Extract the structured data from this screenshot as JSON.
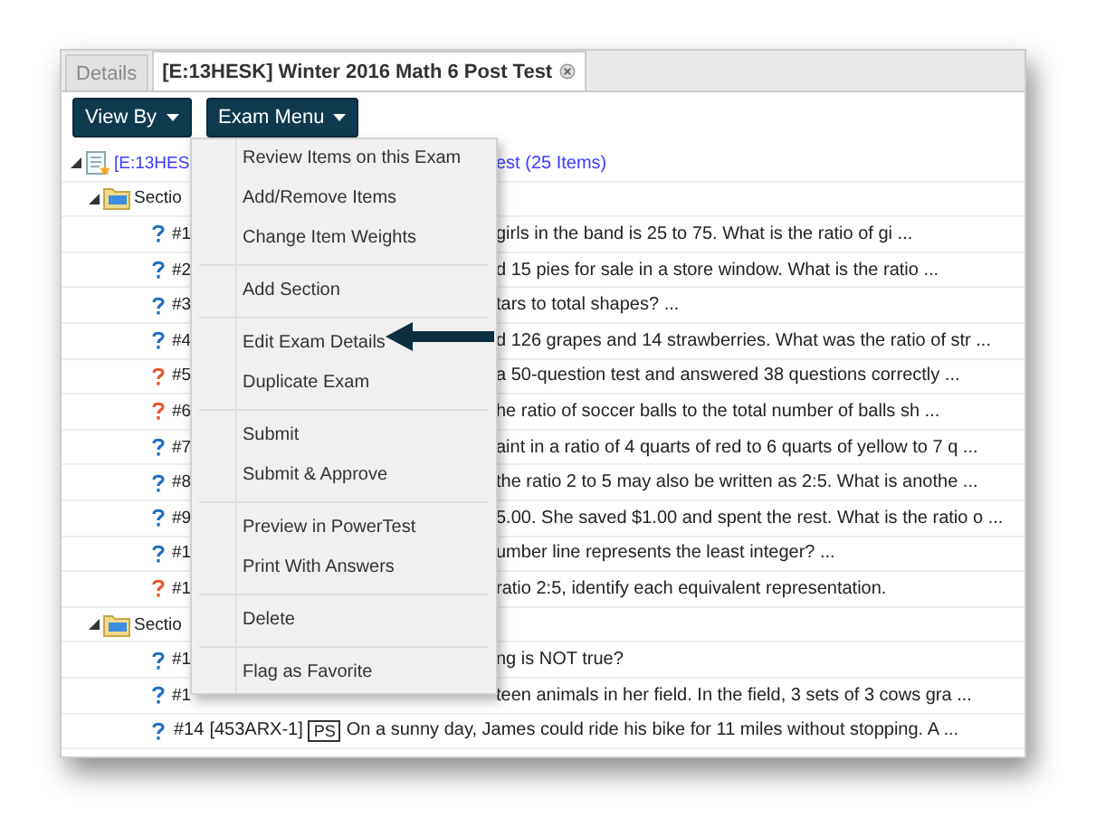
{
  "tabs": [
    {
      "label": "Details",
      "selected": false,
      "closable": false
    },
    {
      "label": "[E:13HESK] Winter 2016 Math 6 Post Test",
      "selected": true,
      "closable": true
    }
  ],
  "toolbar": [
    "View By",
    "Exam Menu"
  ],
  "tree": {
    "label_left": "[E:13HES",
    "label_right": "est (25 Items)",
    "expanded": true,
    "children": [
      {
        "label": "Sectio",
        "expanded": true,
        "children": [
          {
            "kind": "covered",
            "number": "#1",
            "text": "girls in the band is 25 to 75. What is the ratio of gi ...",
            "color": "#1f6fc5"
          },
          {
            "kind": "covered",
            "number": "#2",
            "text": "d 15 pies for sale in a store window. What is the ratio ...",
            "color": "#1f6fc5"
          },
          {
            "kind": "covered",
            "number": "#3",
            "text": "tars to total shapes? ...",
            "color": "#1f6fc5"
          },
          {
            "kind": "covered",
            "number": "#4",
            "text": "d 126 grapes and 14 strawberries. What was the ratio of str ...",
            "color": "#1f6fc5"
          },
          {
            "kind": "covered",
            "number": "#5",
            "text": "a 50-question test and answered 38 questions correctly ...",
            "color": "#e8562a"
          },
          {
            "kind": "covered",
            "number": "#6",
            "text": "he ratio of soccer balls to the total number of balls sh ...",
            "color": "#e8562a"
          },
          {
            "kind": "covered",
            "number": "#7",
            "text": "aint in a ratio of 4 quarts of red to 6 quarts of yellow to 7 q ...",
            "color": "#1f6fc5"
          },
          {
            "kind": "covered",
            "number": "#8",
            "text": "the ratio 2 to 5 may also be written as 2:5. What is anothe ...",
            "color": "#1f6fc5"
          },
          {
            "kind": "covered",
            "number": "#9",
            "text": "5.00. She saved $1.00 and spent the rest. What is the ratio o ...",
            "color": "#1f6fc5"
          },
          {
            "kind": "covered",
            "number": "#1",
            "text": "umber line represents the least integer? ...",
            "color": "#1f6fc5"
          },
          {
            "kind": "covered",
            "number": "#1",
            "text": "ratio 2:5, identify each equivalent representation.",
            "color": "#e8562a"
          }
        ]
      },
      {
        "label": "Sectio",
        "expanded": true,
        "children": [
          {
            "kind": "covered",
            "number": "#1",
            "text": "ng is NOT true?",
            "color": "#1f6fc5"
          },
          {
            "kind": "covered",
            "number": "#1",
            "text": "teen animals in her field. In the field, 3 sets of 3 cows gra ...",
            "color": "#1f6fc5"
          },
          {
            "kind": "full",
            "number": "#14",
            "code": "[453ARX-1]",
            "tag": "PS",
            "text": "On a sunny day, James could ride his bike for 11 miles without stopping. A ...",
            "color": "#1f6fc5"
          }
        ]
      }
    ]
  },
  "menu": [
    [
      "Review Items on this Exam",
      "Add/Remove Items",
      "Change Item Weights"
    ],
    [
      "Add Section"
    ],
    [
      "Edit Exam Details",
      "Duplicate Exam"
    ],
    [
      "Submit",
      "Submit & Approve"
    ],
    [
      "Preview in PowerTest",
      "Print With Answers"
    ],
    [
      "Delete"
    ],
    [
      "Flag as Favorite"
    ]
  ]
}
